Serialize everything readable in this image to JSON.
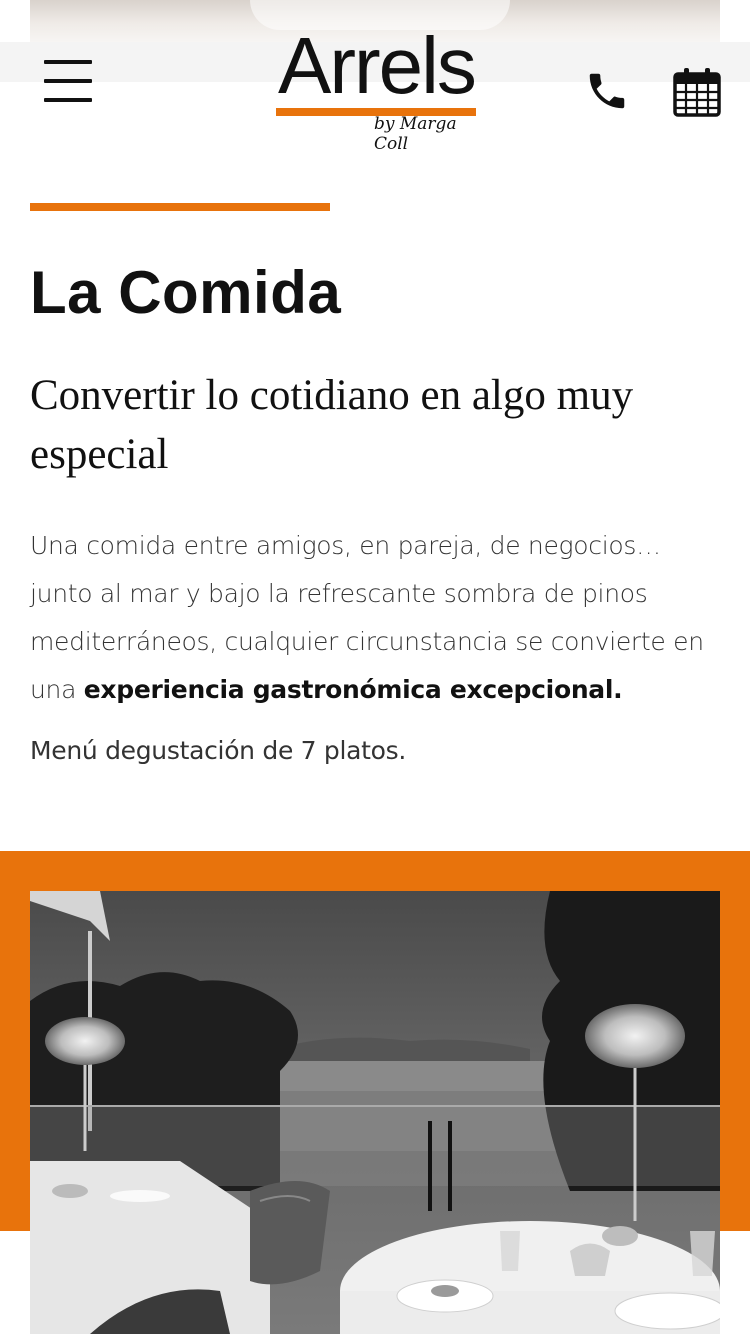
{
  "header": {
    "logo_text": "Arrels",
    "logo_sub": "by Marga Coll",
    "menu_icon": "hamburger-menu-icon",
    "phone_icon": "phone-icon",
    "calendar_icon": "calendar-icon"
  },
  "section": {
    "title": "La Comida",
    "subtitle": "Convertir lo cotidiano en algo muy especial",
    "intro_text": "Una comida entre amigos, en pareja, de negocios… junto al mar y bajo la refrescante sombra de pinos mediterráneos, cualquier circunstancia se convierte en una ",
    "intro_highlight": "experiencia gastronómica excepcional.",
    "menu_note": "Menú degustación de 7 platos."
  },
  "colors": {
    "accent": "#e8730c",
    "text": "#111111",
    "background": "#ffffff"
  }
}
